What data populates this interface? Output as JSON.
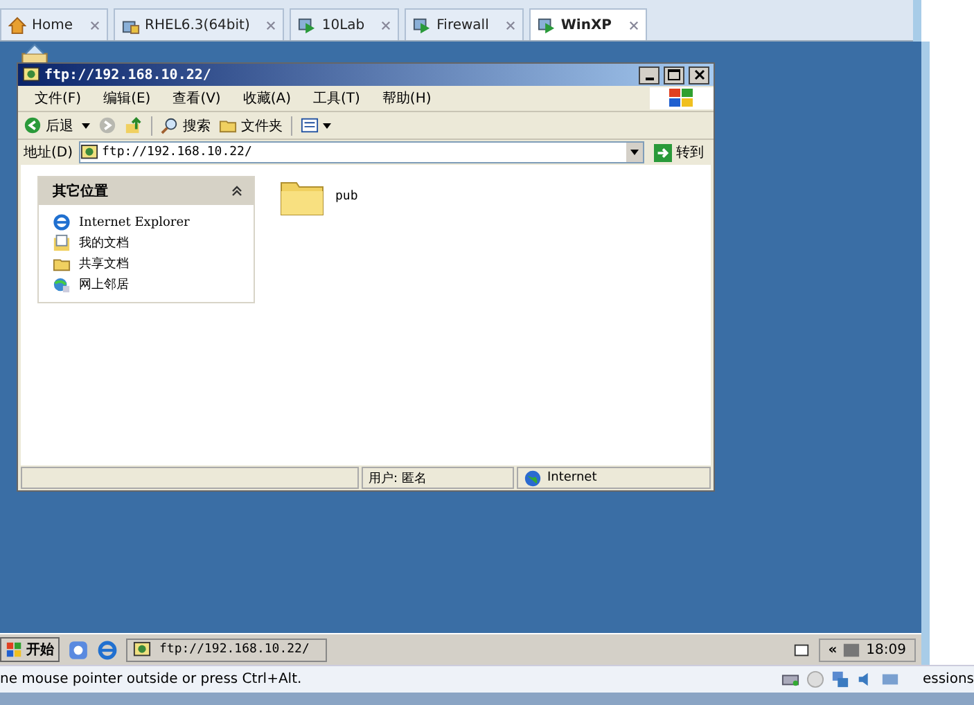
{
  "tabs": [
    {
      "label": "Home",
      "kind": "home",
      "selected": false
    },
    {
      "label": "RHEL6.3(64bit)",
      "kind": "locked",
      "selected": false
    },
    {
      "label": "10Lab",
      "kind": "vm",
      "selected": false
    },
    {
      "label": "Firewall",
      "kind": "vm",
      "selected": false
    },
    {
      "label": "WinXP",
      "kind": "vm",
      "selected": true
    }
  ],
  "window": {
    "title": "ftp://192.168.10.22/",
    "menu": [
      "文件(F)",
      "编辑(E)",
      "查看(V)",
      "收藏(A)",
      "工具(T)",
      "帮助(H)"
    ],
    "toolbar": {
      "back": "后退",
      "search": "搜索",
      "folders": "文件夹"
    },
    "address": {
      "label": "地址(D)",
      "value": "ftp://192.168.10.22/",
      "go": "转到"
    },
    "panel": {
      "title": "其它位置",
      "items": [
        {
          "label": "Internet Explorer",
          "kind": "ie"
        },
        {
          "label": "我的文档",
          "kind": "docs"
        },
        {
          "label": "共享文档",
          "kind": "folder"
        },
        {
          "label": "网上邻居",
          "kind": "network"
        }
      ]
    },
    "files": [
      {
        "name": "pub"
      }
    ],
    "status_bar": {
      "user": "用户: 匿名",
      "zone": "Internet"
    }
  },
  "taskbar": {
    "start": "开始",
    "task": "ftp://192.168.10.22/",
    "chevron": "«",
    "clock": "18:09"
  },
  "vm_status": {
    "hint": "ne mouse pointer outside or press Ctrl+Alt.",
    "right": "essions"
  }
}
